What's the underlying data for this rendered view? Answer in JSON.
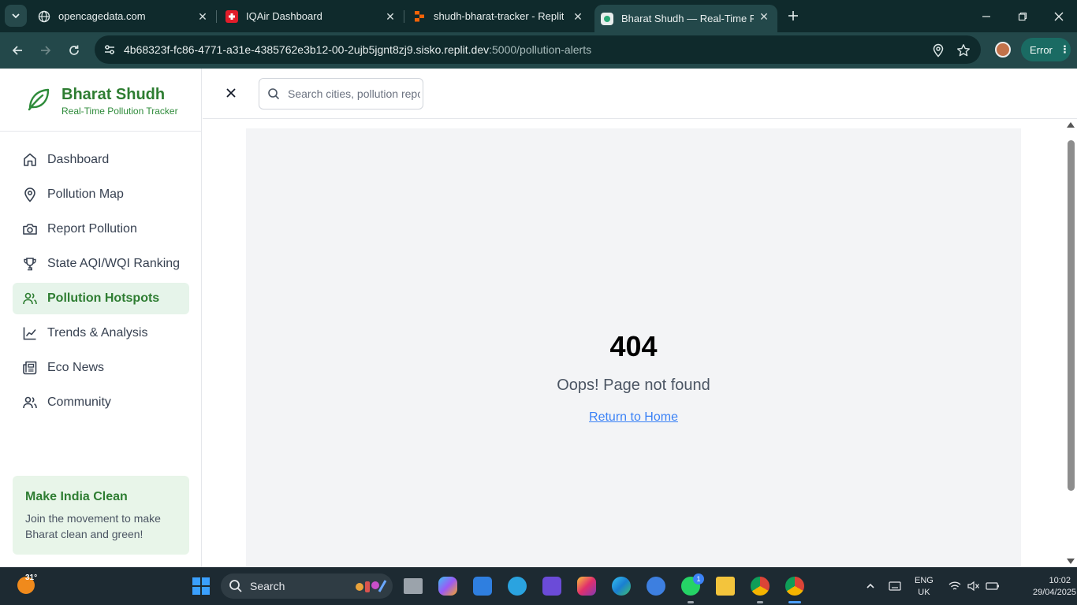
{
  "browser": {
    "tabs": [
      {
        "title": "opencagedata.com",
        "icon": "globe-icon"
      },
      {
        "title": "IQAir Dashboard",
        "icon": "swiss-cross-icon"
      },
      {
        "title": "shudh-bharat-tracker - Replit",
        "icon": "replit-icon"
      },
      {
        "title": "Bharat Shudh — Real-Time Polli",
        "icon": "leaf-favicon-icon"
      }
    ],
    "url_main": "4b68323f-fc86-4771-a31e-4385762e3b12-00-2ujb5jgnt8zj9.sisko.replit.dev",
    "url_rest": ":5000/pollution-alerts",
    "error_label": "Error"
  },
  "sidebar": {
    "brand_name": "Bharat Shudh",
    "brand_tagline": "Real-Time Pollution Tracker",
    "items": [
      {
        "label": "Dashboard",
        "icon": "home-icon"
      },
      {
        "label": "Pollution Map",
        "icon": "map-pin-icon"
      },
      {
        "label": "Report Pollution",
        "icon": "camera-icon"
      },
      {
        "label": "State AQI/WQI Ranking",
        "icon": "trophy-icon"
      },
      {
        "label": "Pollution Hotspots",
        "icon": "users-icon",
        "active": true
      },
      {
        "label": "Trends & Analysis",
        "icon": "trend-chart-icon"
      },
      {
        "label": "Eco News",
        "icon": "newspaper-icon"
      },
      {
        "label": "Community",
        "icon": "community-icon"
      }
    ],
    "promo": {
      "title": "Make India Clean",
      "text": "Join the movement to make Bharat clean and green!"
    }
  },
  "header": {
    "search_placeholder": "Search cities, pollution reports..."
  },
  "main": {
    "error_code": "404",
    "message": "Oops! Page not found",
    "home_link": "Return to Home"
  },
  "taskbar": {
    "temperature": "31°",
    "search_label": "Search",
    "notification_count": "1",
    "lang_top": "ENG",
    "lang_bottom": "UK",
    "time": "10:02",
    "date": "29/04/2025"
  },
  "colors": {
    "brand_green": "#2e7d32",
    "active_bg": "#e6f4ea",
    "link_blue": "#3b82f6",
    "browser_frame": "#23484a"
  }
}
